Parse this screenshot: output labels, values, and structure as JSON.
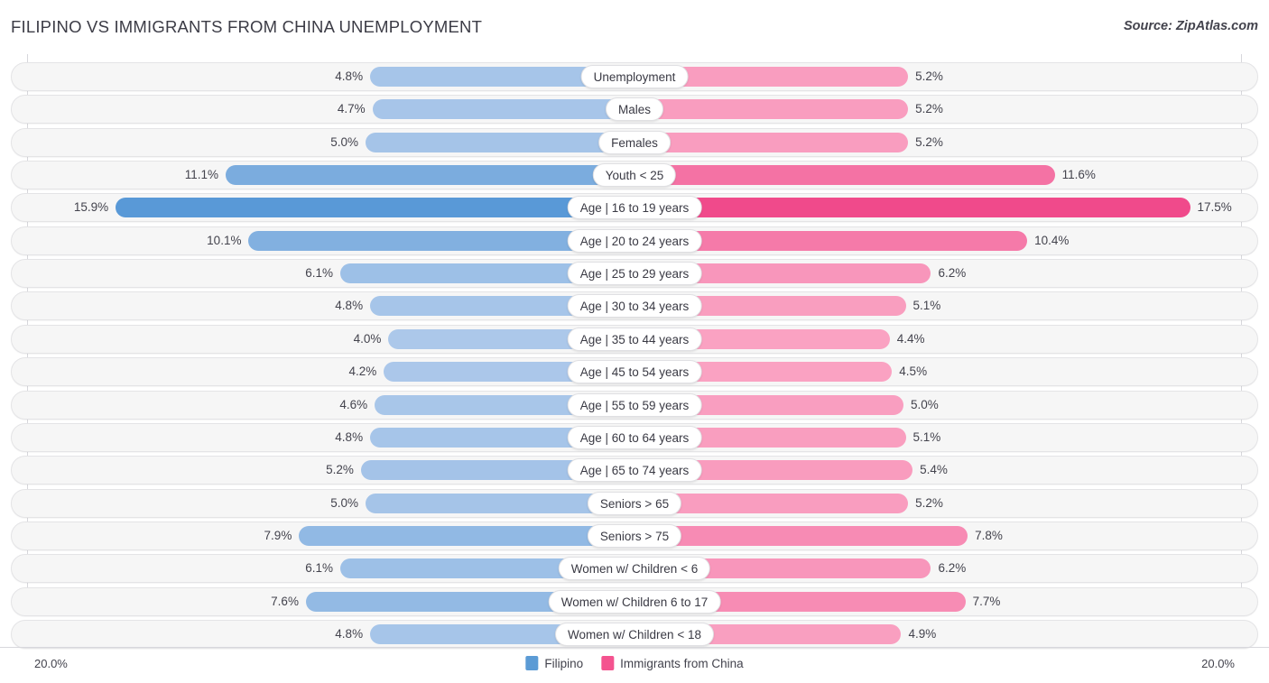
{
  "header": {
    "title": "FILIPINO VS IMMIGRANTS FROM CHINA UNEMPLOYMENT",
    "source": "Source: ZipAtlas.com"
  },
  "legend": {
    "items": [
      {
        "label": "Filipino",
        "color": "#5b9bd5"
      },
      {
        "label": "Immigrants from China",
        "color": "#f4538f"
      }
    ]
  },
  "axis": {
    "left_label": "20.0%",
    "right_label": "20.0%",
    "max": 20.0
  },
  "chart_data": {
    "type": "bar",
    "title": "FILIPINO VS IMMIGRANTS FROM CHINA UNEMPLOYMENT",
    "subtitle": "Source: ZipAtlas.com",
    "orientation": "horizontal-diverging",
    "xlabel": "",
    "ylabel": "",
    "xlim": [
      20.0,
      20.0
    ],
    "grid": true,
    "legend_position": "bottom-center",
    "categories": [
      "Unemployment",
      "Males",
      "Females",
      "Youth < 25",
      "Age | 16 to 19 years",
      "Age | 20 to 24 years",
      "Age | 25 to 29 years",
      "Age | 30 to 34 years",
      "Age | 35 to 44 years",
      "Age | 45 to 54 years",
      "Age | 55 to 59 years",
      "Age | 60 to 64 years",
      "Age | 65 to 74 years",
      "Seniors > 65",
      "Seniors > 75",
      "Women w/ Children < 6",
      "Women w/ Children 6 to 17",
      "Women w/ Children < 18"
    ],
    "series": [
      {
        "name": "Filipino",
        "color": "#5b9bd5",
        "side": "left",
        "values": [
          4.8,
          4.7,
          5.0,
          11.1,
          15.9,
          10.1,
          6.1,
          4.8,
          4.0,
          4.2,
          4.6,
          4.8,
          5.2,
          5.0,
          7.9,
          6.1,
          7.6,
          4.8
        ],
        "labels": [
          "4.8%",
          "4.7%",
          "5.0%",
          "11.1%",
          "15.9%",
          "10.1%",
          "6.1%",
          "4.8%",
          "4.0%",
          "4.2%",
          "4.6%",
          "4.8%",
          "5.2%",
          "5.0%",
          "7.9%",
          "6.1%",
          "7.6%",
          "4.8%"
        ]
      },
      {
        "name": "Immigrants from China",
        "color": "#f4538f",
        "side": "right",
        "values": [
          5.2,
          5.2,
          5.2,
          11.6,
          17.5,
          10.4,
          6.2,
          5.1,
          4.4,
          4.5,
          5.0,
          5.1,
          5.4,
          5.2,
          7.8,
          6.2,
          7.7,
          4.9
        ],
        "labels": [
          "5.2%",
          "5.2%",
          "5.2%",
          "11.6%",
          "17.5%",
          "10.4%",
          "6.2%",
          "5.1%",
          "4.4%",
          "4.5%",
          "5.0%",
          "5.1%",
          "5.4%",
          "5.2%",
          "7.8%",
          "6.2%",
          "7.7%",
          "4.9%"
        ]
      }
    ]
  }
}
